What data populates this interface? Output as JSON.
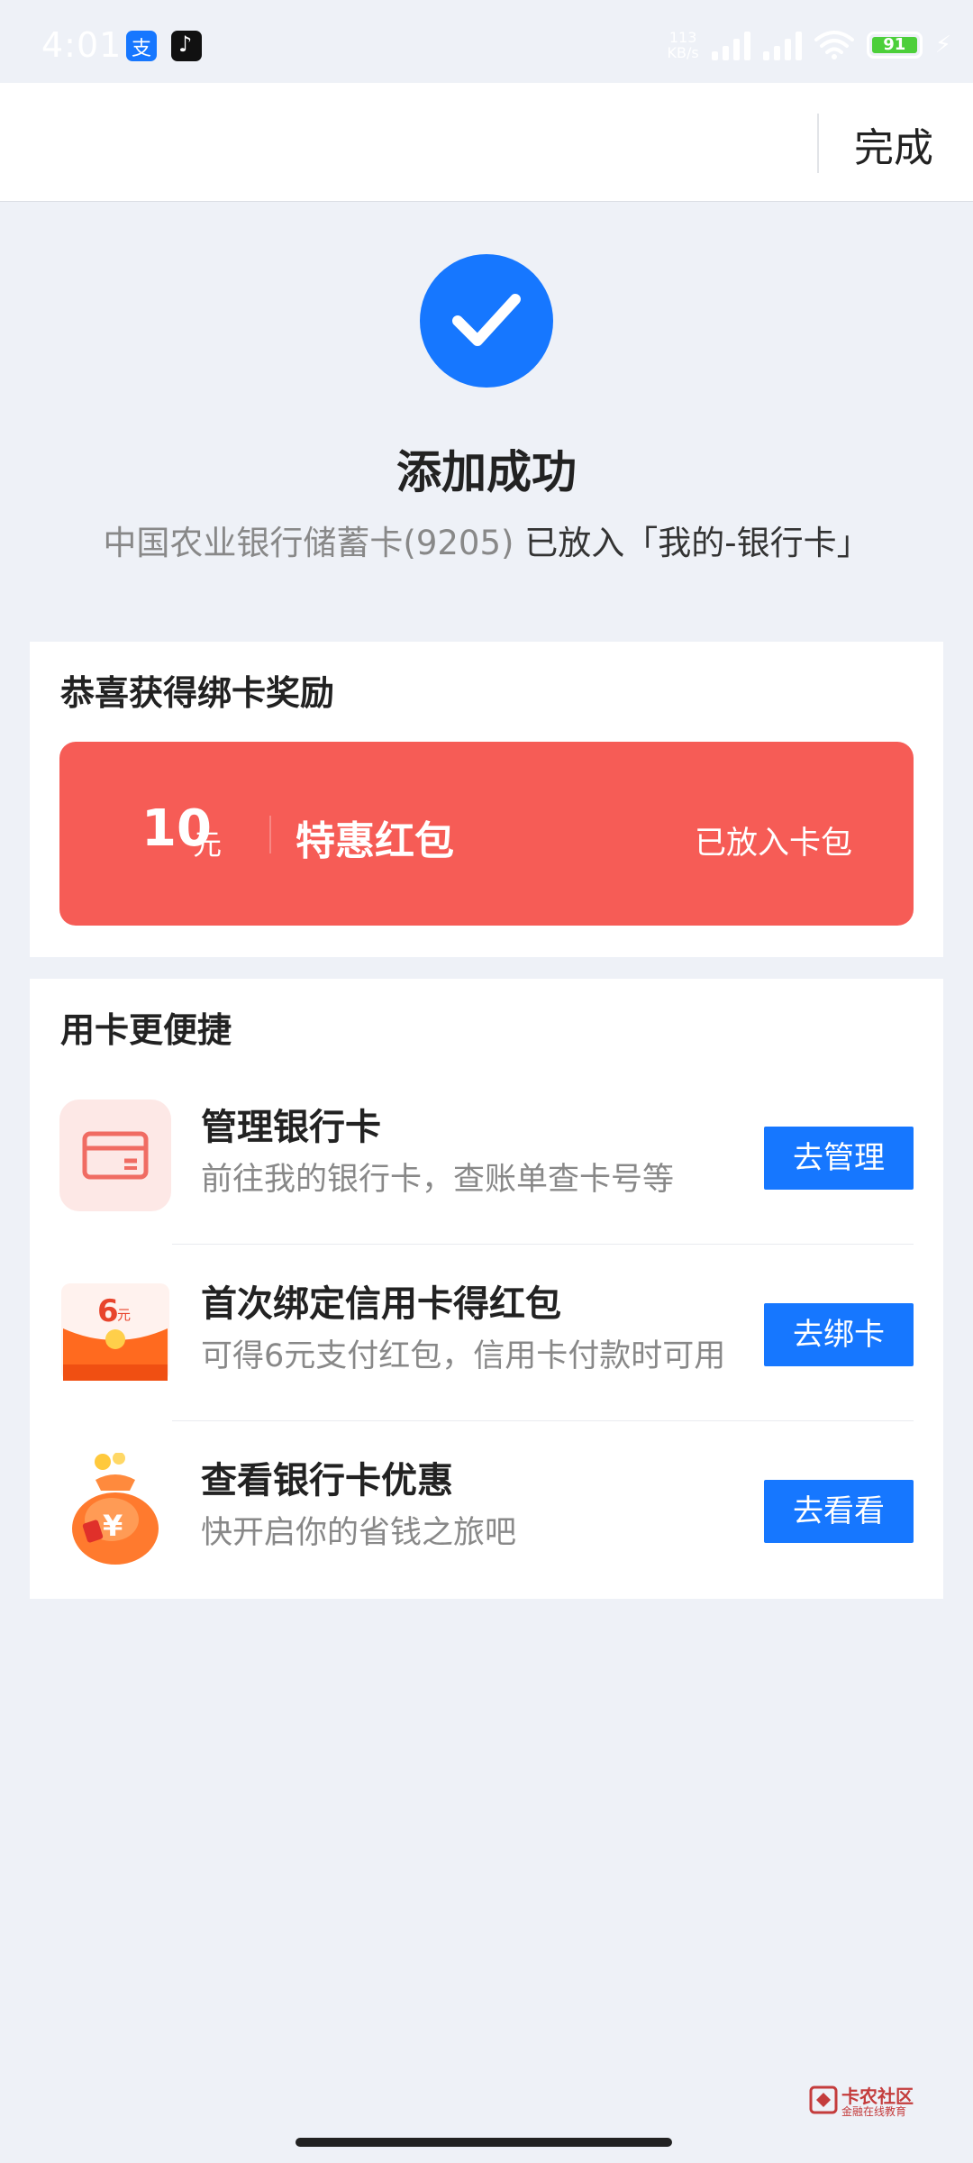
{
  "status_bar": {
    "time": "4:01",
    "net_speed_value": "113",
    "net_speed_unit": "KB/s",
    "battery": "91"
  },
  "header": {
    "done_label": "完成"
  },
  "success": {
    "title": "添加成功",
    "desc_prefix": "中国农业银行储蓄卡(9205)",
    "desc_suffix": " 已放入「我的-银行卡」"
  },
  "reward": {
    "section_title": "恭喜获得绑卡奖励",
    "amount": "10",
    "unit": "元",
    "name": "特惠红包",
    "status": "已放入卡包",
    "color": "#f65c56"
  },
  "features": {
    "section_title": "用卡更便捷",
    "items": [
      {
        "icon": "bank-card-icon",
        "title": "管理银行卡",
        "subtitle": "前往我的银行卡，查账单查卡号等",
        "button": "去管理"
      },
      {
        "icon": "red-envelope-icon",
        "title": "首次绑定信用卡得红包",
        "subtitle": "可得6元支付红包，信用卡付款时可用",
        "button": "去绑卡",
        "icon_text": "6",
        "icon_unit": "元"
      },
      {
        "icon": "money-bag-icon",
        "title": "查看银行卡优惠",
        "subtitle": "快开启你的省钱之旅吧",
        "button": "去看看",
        "icon_text": "¥"
      }
    ]
  },
  "watermark": {
    "name": "卡农社区",
    "sub": "金融在线教育"
  },
  "accent_color": "#1677ff"
}
